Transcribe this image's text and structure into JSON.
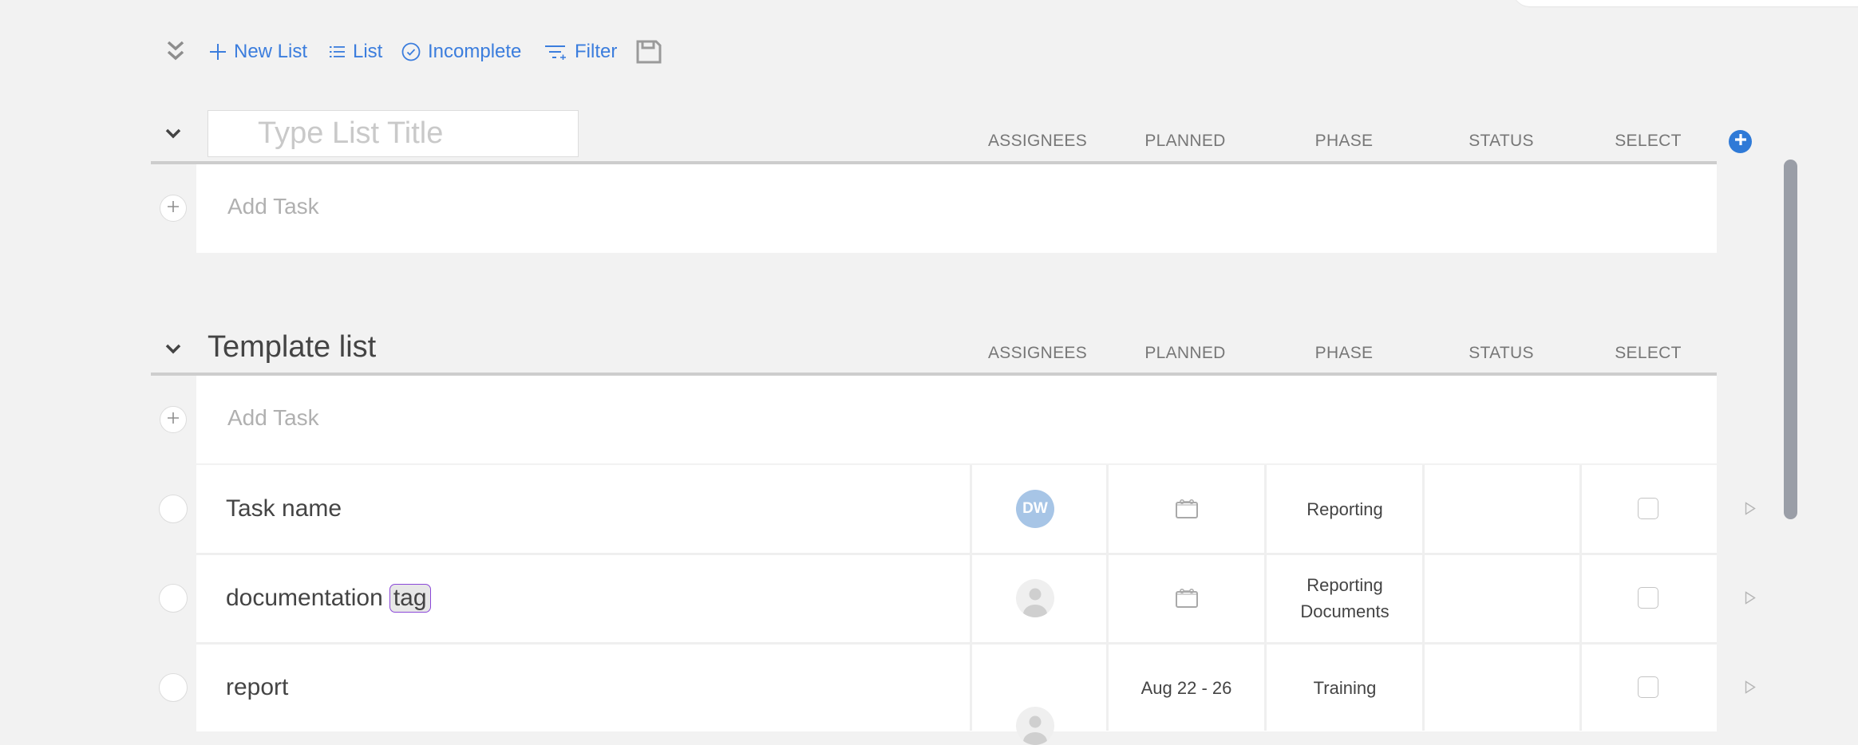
{
  "toolbar": {
    "collapse_all_icon": "double-chevron-down-icon",
    "new_list": {
      "label": "New List",
      "icon": "plus-icon"
    },
    "view": {
      "label": "List",
      "icon": "list-icon"
    },
    "completion_filter": {
      "label": "Incomplete",
      "icon": "check-circle-icon"
    },
    "filter": {
      "label": "Filter",
      "icon": "filter-icon"
    },
    "save_icon": "save-icon"
  },
  "columns": [
    "ASSIGNEES",
    "PLANNED",
    "PHASE",
    "STATUS",
    "SELECT"
  ],
  "new_list": {
    "title_value": "",
    "title_placeholder": "Type List Title",
    "add_task_label": "Add Task"
  },
  "template_list": {
    "title": "Template list",
    "add_task_label": "Add Task",
    "tasks": [
      {
        "name": "Task name",
        "tag": null,
        "assignee": {
          "initials": "DW",
          "color": "#a7c5e6"
        },
        "planned": null,
        "phase": "Reporting",
        "status": "",
        "selected": false
      },
      {
        "name": "documentation",
        "tag": "tag",
        "assignee": null,
        "planned": null,
        "phase": "Reporting Documents",
        "status": "",
        "selected": false
      },
      {
        "name": "report",
        "tag": null,
        "assignee": null,
        "planned": "Aug 22 - 26",
        "phase": "Training",
        "status": "",
        "selected": false
      }
    ]
  },
  "colors": {
    "accent": "#3b7ddd",
    "add_button": "#2f7ad7",
    "tag_border": "#8b48d8",
    "background": "#f2f2f2"
  }
}
